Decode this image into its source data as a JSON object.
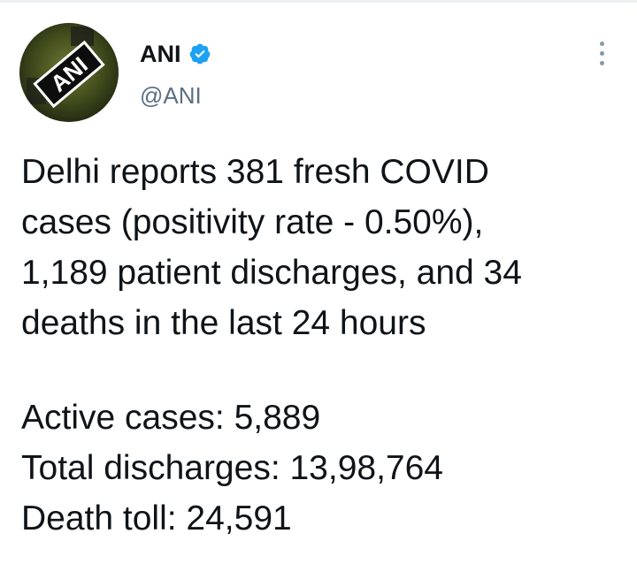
{
  "author": {
    "name": "ANI",
    "handle": "@ANI",
    "verified": true,
    "avatar_icon": "ani-logo-icon",
    "avatar_text": "ANI",
    "verified_color": "#1da1f2"
  },
  "menu": {
    "icon": "more-options-icon"
  },
  "tweet": {
    "lines": [
      "Delhi reports 381 fresh COVID",
      "cases (positivity rate - 0.50%),",
      "1,189 patient discharges, and 34",
      "deaths in the last 24 hours"
    ],
    "stats": [
      "Active cases: 5,889",
      "Total discharges: 13,98,764",
      "Death toll: 24,591"
    ]
  }
}
